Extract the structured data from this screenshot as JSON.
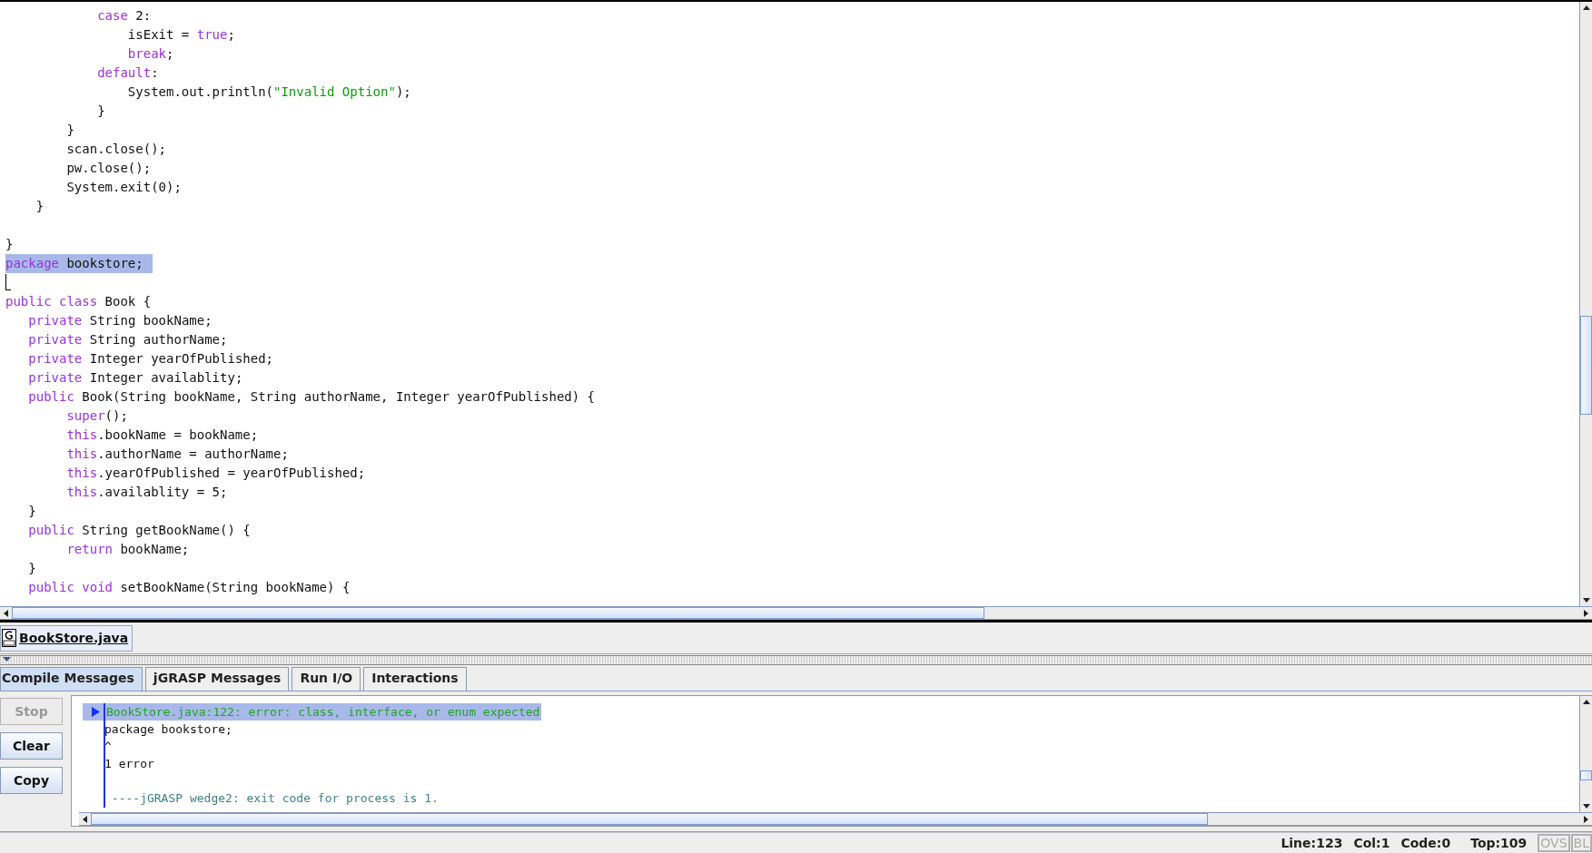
{
  "editor": {
    "lines": [
      {
        "tokens": [
          {
            "kind": "kw",
            "text": "            case"
          },
          {
            "kind": "text",
            "text": " 2:"
          }
        ],
        "selected": false,
        "cursor": false
      },
      {
        "tokens": [
          {
            "kind": "text",
            "text": "                isExit = "
          },
          {
            "kind": "kw",
            "text": "true"
          },
          {
            "kind": "text",
            "text": ";"
          }
        ],
        "selected": false,
        "cursor": false
      },
      {
        "tokens": [
          {
            "kind": "kw",
            "text": "                break"
          },
          {
            "kind": "text",
            "text": ";"
          }
        ],
        "selected": false,
        "cursor": false
      },
      {
        "tokens": [
          {
            "kind": "kw",
            "text": "            default"
          },
          {
            "kind": "text",
            "text": ":"
          }
        ],
        "selected": false,
        "cursor": false
      },
      {
        "tokens": [
          {
            "kind": "text",
            "text": "                System.out.println("
          },
          {
            "kind": "str",
            "text": "\"Invalid Option\""
          },
          {
            "kind": "text",
            "text": ");"
          }
        ],
        "selected": false,
        "cursor": false
      },
      {
        "tokens": [
          {
            "kind": "text",
            "text": "            }"
          }
        ],
        "selected": false,
        "cursor": false
      },
      {
        "tokens": [
          {
            "kind": "text",
            "text": "        }"
          }
        ],
        "selected": false,
        "cursor": false
      },
      {
        "tokens": [
          {
            "kind": "text",
            "text": "        scan.close();"
          }
        ],
        "selected": false,
        "cursor": false
      },
      {
        "tokens": [
          {
            "kind": "text",
            "text": "        pw.close();"
          }
        ],
        "selected": false,
        "cursor": false
      },
      {
        "tokens": [
          {
            "kind": "text",
            "text": "        System.exit(0);"
          }
        ],
        "selected": false,
        "cursor": false
      },
      {
        "tokens": [
          {
            "kind": "text",
            "text": "    }"
          }
        ],
        "selected": false,
        "cursor": false
      },
      {
        "selected": false,
        "cursor": false
      },
      {
        "tokens": [
          {
            "kind": "text",
            "text": "}"
          }
        ],
        "selected": false,
        "cursor": false
      },
      {
        "tokens": [
          {
            "kind": "kw",
            "text": "package"
          },
          {
            "kind": "text",
            "text": " bookstore; "
          }
        ],
        "selected": true,
        "cursor": false
      },
      {
        "selected": false,
        "cursor": true
      },
      {
        "tokens": [
          {
            "kind": "kw",
            "text": "public class"
          },
          {
            "kind": "text",
            "text": " Book {"
          }
        ],
        "selected": false,
        "cursor": false
      },
      {
        "tokens": [
          {
            "kind": "kw",
            "text": "   private"
          },
          {
            "kind": "text",
            "text": " String bookName;"
          }
        ],
        "selected": false,
        "cursor": false
      },
      {
        "tokens": [
          {
            "kind": "kw",
            "text": "   private"
          },
          {
            "kind": "text",
            "text": " String authorName;"
          }
        ],
        "selected": false,
        "cursor": false
      },
      {
        "tokens": [
          {
            "kind": "kw",
            "text": "   private"
          },
          {
            "kind": "text",
            "text": " Integer yearOfPublished;"
          }
        ],
        "selected": false,
        "cursor": false
      },
      {
        "tokens": [
          {
            "kind": "kw",
            "text": "   private"
          },
          {
            "kind": "text",
            "text": " Integer availablity;"
          }
        ],
        "selected": false,
        "cursor": false
      },
      {
        "tokens": [
          {
            "kind": "kw",
            "text": "   public"
          },
          {
            "kind": "text",
            "text": " Book(String bookName, String authorName, Integer yearOfPublished) {"
          }
        ],
        "selected": false,
        "cursor": false
      },
      {
        "tokens": [
          {
            "kind": "kw",
            "text": "        super"
          },
          {
            "kind": "text",
            "text": "();"
          }
        ],
        "selected": false,
        "cursor": false
      },
      {
        "tokens": [
          {
            "kind": "kw",
            "text": "        this"
          },
          {
            "kind": "text",
            "text": ".bookName = bookName;"
          }
        ],
        "selected": false,
        "cursor": false
      },
      {
        "tokens": [
          {
            "kind": "kw",
            "text": "        this"
          },
          {
            "kind": "text",
            "text": ".authorName = authorName;"
          }
        ],
        "selected": false,
        "cursor": false
      },
      {
        "tokens": [
          {
            "kind": "kw",
            "text": "        this"
          },
          {
            "kind": "text",
            "text": ".yearOfPublished = yearOfPublished;"
          }
        ],
        "selected": false,
        "cursor": false
      },
      {
        "tokens": [
          {
            "kind": "kw",
            "text": "        this"
          },
          {
            "kind": "text",
            "text": ".availablity = 5;"
          }
        ],
        "selected": false,
        "cursor": false
      },
      {
        "tokens": [
          {
            "kind": "text",
            "text": "   }"
          }
        ],
        "selected": false,
        "cursor": false
      },
      {
        "tokens": [
          {
            "kind": "kw",
            "text": "   public"
          },
          {
            "kind": "text",
            "text": " String getBookName() {"
          }
        ],
        "selected": false,
        "cursor": false
      },
      {
        "tokens": [
          {
            "kind": "kw",
            "text": "        return"
          },
          {
            "kind": "text",
            "text": " bookName;"
          }
        ],
        "selected": false,
        "cursor": false
      },
      {
        "tokens": [
          {
            "kind": "text",
            "text": "   }"
          }
        ],
        "selected": false,
        "cursor": false
      },
      {
        "tokens": [
          {
            "kind": "kw",
            "text": "   public void"
          },
          {
            "kind": "text",
            "text": " setBookName(String bookName) {"
          }
        ],
        "selected": false,
        "cursor": false
      }
    ]
  },
  "file_tabs": [
    {
      "label": "BookStore.java",
      "selected": true
    }
  ],
  "message_tabs": [
    {
      "label": "Compile Messages",
      "selected": true
    },
    {
      "label": "jGRASP Messages",
      "selected": false
    },
    {
      "label": "Run I/O",
      "selected": false
    },
    {
      "label": "Interactions",
      "selected": false
    }
  ],
  "buttons": [
    {
      "label": "Stop",
      "disabled": true
    },
    {
      "label": "Clear",
      "disabled": false
    },
    {
      "label": "Copy",
      "disabled": false
    }
  ],
  "messages": [
    {
      "text": "BookStore.java:122: error: class, interface, or enum expected",
      "kind": "error",
      "selected": true
    },
    {
      "text": "package bookstore;",
      "kind": "output",
      "selected": false
    },
    {
      "text": "^",
      "kind": "output",
      "selected": false
    },
    {
      "text": "1 error",
      "kind": "output",
      "selected": false
    },
    {
      "text": " ----jGRASP wedge2: exit code for process is 1.",
      "kind": "note",
      "selected": false
    }
  ],
  "status_bar": [
    {
      "text": "Line:123",
      "kind": "info"
    },
    {
      "text": "Col:1",
      "kind": "info"
    },
    {
      "text": "Code:0",
      "kind": "info"
    },
    {
      "text": "Top:109",
      "kind": "info"
    },
    {
      "text": "OVS",
      "kind": "mode",
      "on": false
    },
    {
      "text": "BL",
      "kind": "mode",
      "on": false
    }
  ]
}
